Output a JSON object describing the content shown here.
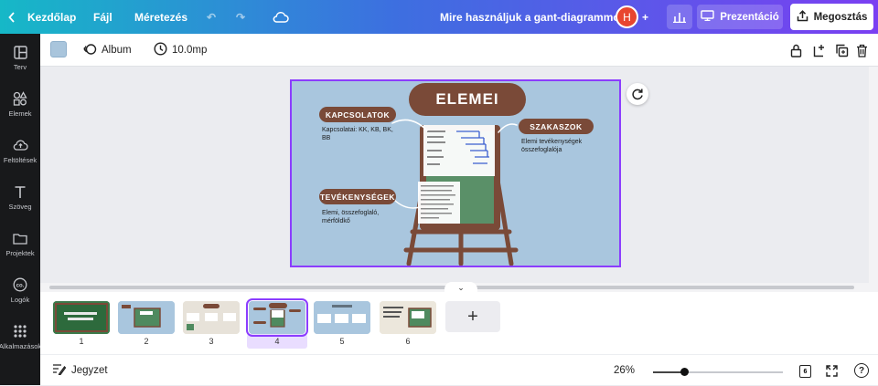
{
  "topbar": {
    "home_label": "Kezdőlap",
    "file_label": "Fájl",
    "resize_label": "Méretezés",
    "doc_title": "Mire használjuk a gant-diagrammot?",
    "avatar_initial": "H",
    "present_label": "Prezentáció",
    "share_label": "Megosztás",
    "icons": [
      "back-icon",
      "undo-icon",
      "redo-icon",
      "cloud-icon",
      "plus-icon",
      "bar-chart-icon",
      "present-icon",
      "share-icon"
    ]
  },
  "sidebar": {
    "items": [
      {
        "label": "Terv",
        "icon": "layout-icon"
      },
      {
        "label": "Elemek",
        "icon": "shapes-icon"
      },
      {
        "label": "Feltöltések",
        "icon": "upload-icon"
      },
      {
        "label": "Szöveg",
        "icon": "text-icon"
      },
      {
        "label": "Projektek",
        "icon": "folder-icon"
      },
      {
        "label": "Logók",
        "icon": "logo-icon"
      },
      {
        "label": "Alkalmazások",
        "icon": "apps-icon"
      }
    ]
  },
  "toolbar": {
    "swatch_color": "#a9c5dc",
    "animate_label": "Album",
    "duration_label": "10.0mp"
  },
  "slide": {
    "title": "ELEMEI",
    "kapcsolatok": "KAPCSOLATOK",
    "kapcsolatok_note": "Kapcsolatai: KK, KB, BK, BB",
    "szakaszok": "SZAKASZOK",
    "szakaszok_note": "Elemi tevékenységek összefoglalója",
    "tevekenysegek": "TEVÉKENYSÉGEK",
    "tevekenysegek_note": "Elemi, összefoglaló, mérföldkő"
  },
  "pages": {
    "items": [
      {
        "num": "1",
        "active": false
      },
      {
        "num": "2",
        "active": false
      },
      {
        "num": "3",
        "active": false
      },
      {
        "num": "4",
        "active": true
      },
      {
        "num": "5",
        "active": false
      },
      {
        "num": "6",
        "active": false
      }
    ],
    "add_label": "+"
  },
  "bottombar": {
    "notes_label": "Jegyzet",
    "zoom_label": "26%",
    "zoom_level": 0.24,
    "page_count": "6",
    "help_label": "?"
  },
  "colors": {
    "accent": "#8b3dff",
    "brown": "#7a4a38",
    "slide_bg": "#a9c6de",
    "board_green": "#4f8a5f"
  }
}
